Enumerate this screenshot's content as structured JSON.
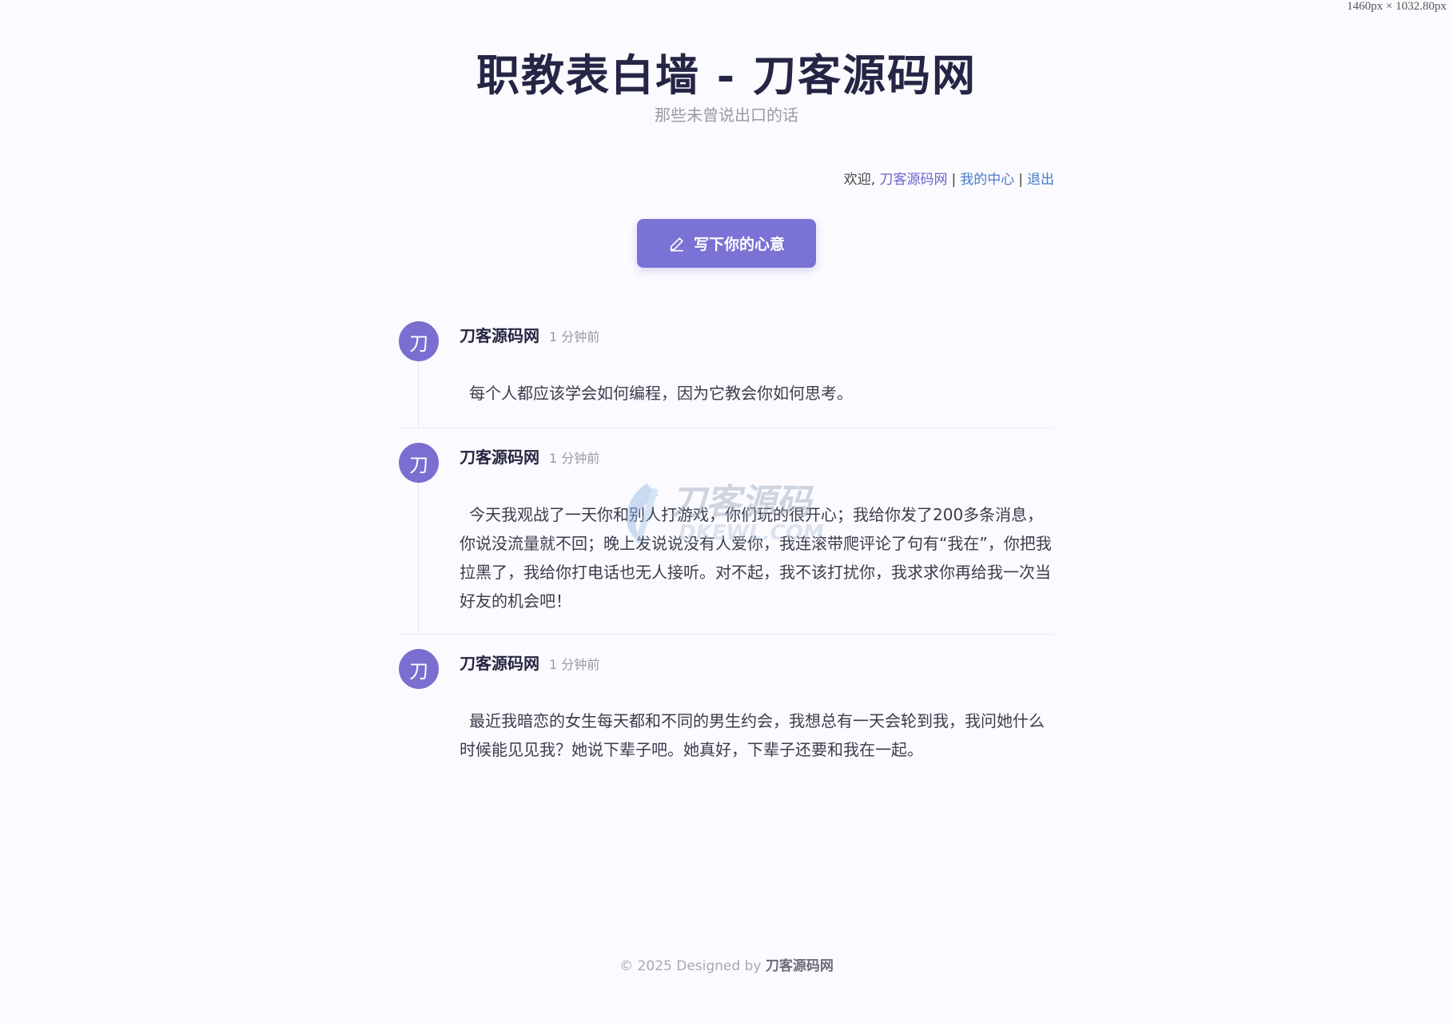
{
  "viewport_label": "1460px × 1032.80px",
  "header": {
    "title": "职教表白墙 - 刀客源码网",
    "subtitle": "那些未曾说出口的话"
  },
  "welcome": {
    "prefix": "欢迎,",
    "user": "刀客源码网",
    "sep": "|",
    "my_center": "我的中心",
    "logout": "退出"
  },
  "write_button": {
    "label": "写下你的心意",
    "icon": "pen-icon"
  },
  "posts": [
    {
      "avatar_text": "刀",
      "author": "刀客源码网",
      "time": "1 分钟前",
      "content": "每个人都应该学会如何编程，因为它教会你如何思考。"
    },
    {
      "avatar_text": "刀",
      "author": "刀客源码网",
      "time": "1 分钟前",
      "content": "今天我观战了一天你和别人打游戏，你们玩的很开心；我给你发了200多条消息，你说没流量就不回；晚上发说说没有人爱你，我连滚带爬评论了句有“我在”，你把我拉黑了，我给你打电话也无人接听。对不起，我不该打扰你，我求求你再给我一次当好友的机会吧！"
    },
    {
      "avatar_text": "刀",
      "author": "刀客源码网",
      "time": "1 分钟前",
      "content": "最近我暗恋的女生每天都和不同的男生约会，我想总有一天会轮到我，我问她什么时候能见见我？她说下辈子吧。她真好，下辈子还要和我在一起。"
    }
  ],
  "watermark": {
    "line1": "刀客源码",
    "line2": "DKEWL.COM"
  },
  "footer": {
    "prefix": "© 2025 Designed by",
    "brand": "刀客源码网"
  },
  "colors": {
    "accent": "#7a72d4",
    "link": "#4a7bc8",
    "background": "#fafaff"
  }
}
